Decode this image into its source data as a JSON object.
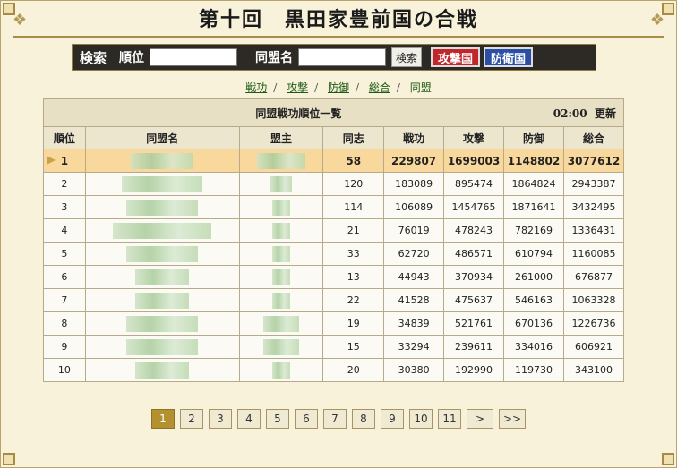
{
  "title": "第十回　黒田家豊前国の合戦",
  "search": {
    "label": "検索",
    "rank_label": "順位",
    "rank_value": "",
    "alliance_label": "同盟名",
    "alliance_value": "",
    "search_button": "検索",
    "attack_button": "攻撃国",
    "defense_button": "防衛国"
  },
  "tabs": [
    {
      "label": "戦功"
    },
    {
      "label": "攻撃"
    },
    {
      "label": "防御"
    },
    {
      "label": "総合"
    },
    {
      "label": "同盟"
    }
  ],
  "table": {
    "caption": "同盟戦功順位一覧",
    "time": "02:00",
    "update": "更新",
    "columns": [
      "順位",
      "同盟名",
      "盟主",
      "同志",
      "戦功",
      "攻撃",
      "防御",
      "総合"
    ],
    "rows": [
      {
        "rank": "1",
        "members": "58",
        "merit": "229807",
        "attack": "1699003",
        "defense": "1148802",
        "total": "3077612"
      },
      {
        "rank": "2",
        "members": "120",
        "merit": "183089",
        "attack": "895474",
        "defense": "1864824",
        "total": "2943387"
      },
      {
        "rank": "3",
        "members": "114",
        "merit": "106089",
        "attack": "1454765",
        "defense": "1871641",
        "total": "3432495"
      },
      {
        "rank": "4",
        "members": "21",
        "merit": "76019",
        "attack": "478243",
        "defense": "782169",
        "total": "1336431"
      },
      {
        "rank": "5",
        "members": "33",
        "merit": "62720",
        "attack": "486571",
        "defense": "610794",
        "total": "1160085"
      },
      {
        "rank": "6",
        "members": "13",
        "merit": "44943",
        "attack": "370934",
        "defense": "261000",
        "total": "676877"
      },
      {
        "rank": "7",
        "members": "22",
        "merit": "41528",
        "attack": "475637",
        "defense": "546163",
        "total": "1063328"
      },
      {
        "rank": "8",
        "members": "19",
        "merit": "34839",
        "attack": "521761",
        "defense": "670136",
        "total": "1226736"
      },
      {
        "rank": "9",
        "members": "15",
        "merit": "33294",
        "attack": "239611",
        "defense": "334016",
        "total": "606921"
      },
      {
        "rank": "10",
        "members": "20",
        "merit": "30380",
        "attack": "192990",
        "defense": "119730",
        "total": "343100"
      }
    ]
  },
  "pagination": {
    "pages": [
      "1",
      "2",
      "3",
      "4",
      "5",
      "6",
      "7",
      "8",
      "9",
      "10",
      "11"
    ],
    "current": "1",
    "next": ">",
    "last": ">>"
  }
}
